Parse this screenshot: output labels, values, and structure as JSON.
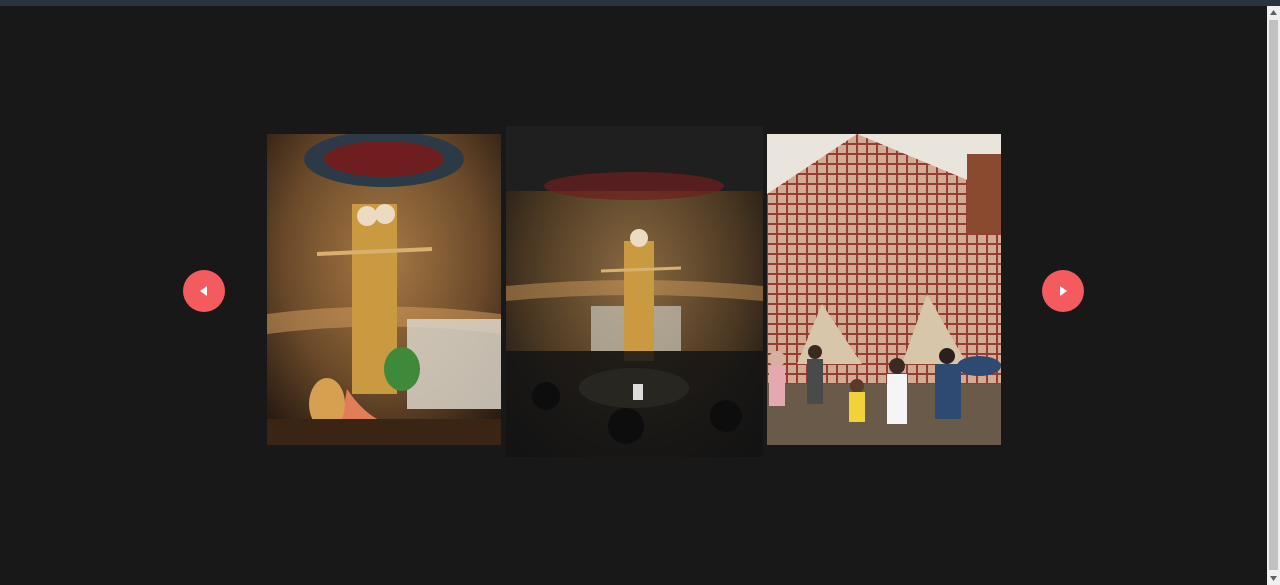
{
  "carousel": {
    "prev_button": {
      "icon": "triangle-left-icon",
      "color": "#f35b5f"
    },
    "next_button": {
      "icon": "triangle-right-icon",
      "color": "#f35b5f"
    },
    "slides": [
      {
        "name": "durga-idol-under-thatched-dome"
      },
      {
        "name": "idol-on-pedestal-with-crowd"
      },
      {
        "name": "red-bamboo-lattice-pandal-exterior"
      }
    ]
  },
  "theme": {
    "background": "#181818",
    "topbar": "#2b3240",
    "accent": "#f35b5f"
  },
  "scrollbar": {
    "up_icon": "scroll-up-arrow-icon",
    "down_icon": "scroll-down-arrow-icon"
  }
}
